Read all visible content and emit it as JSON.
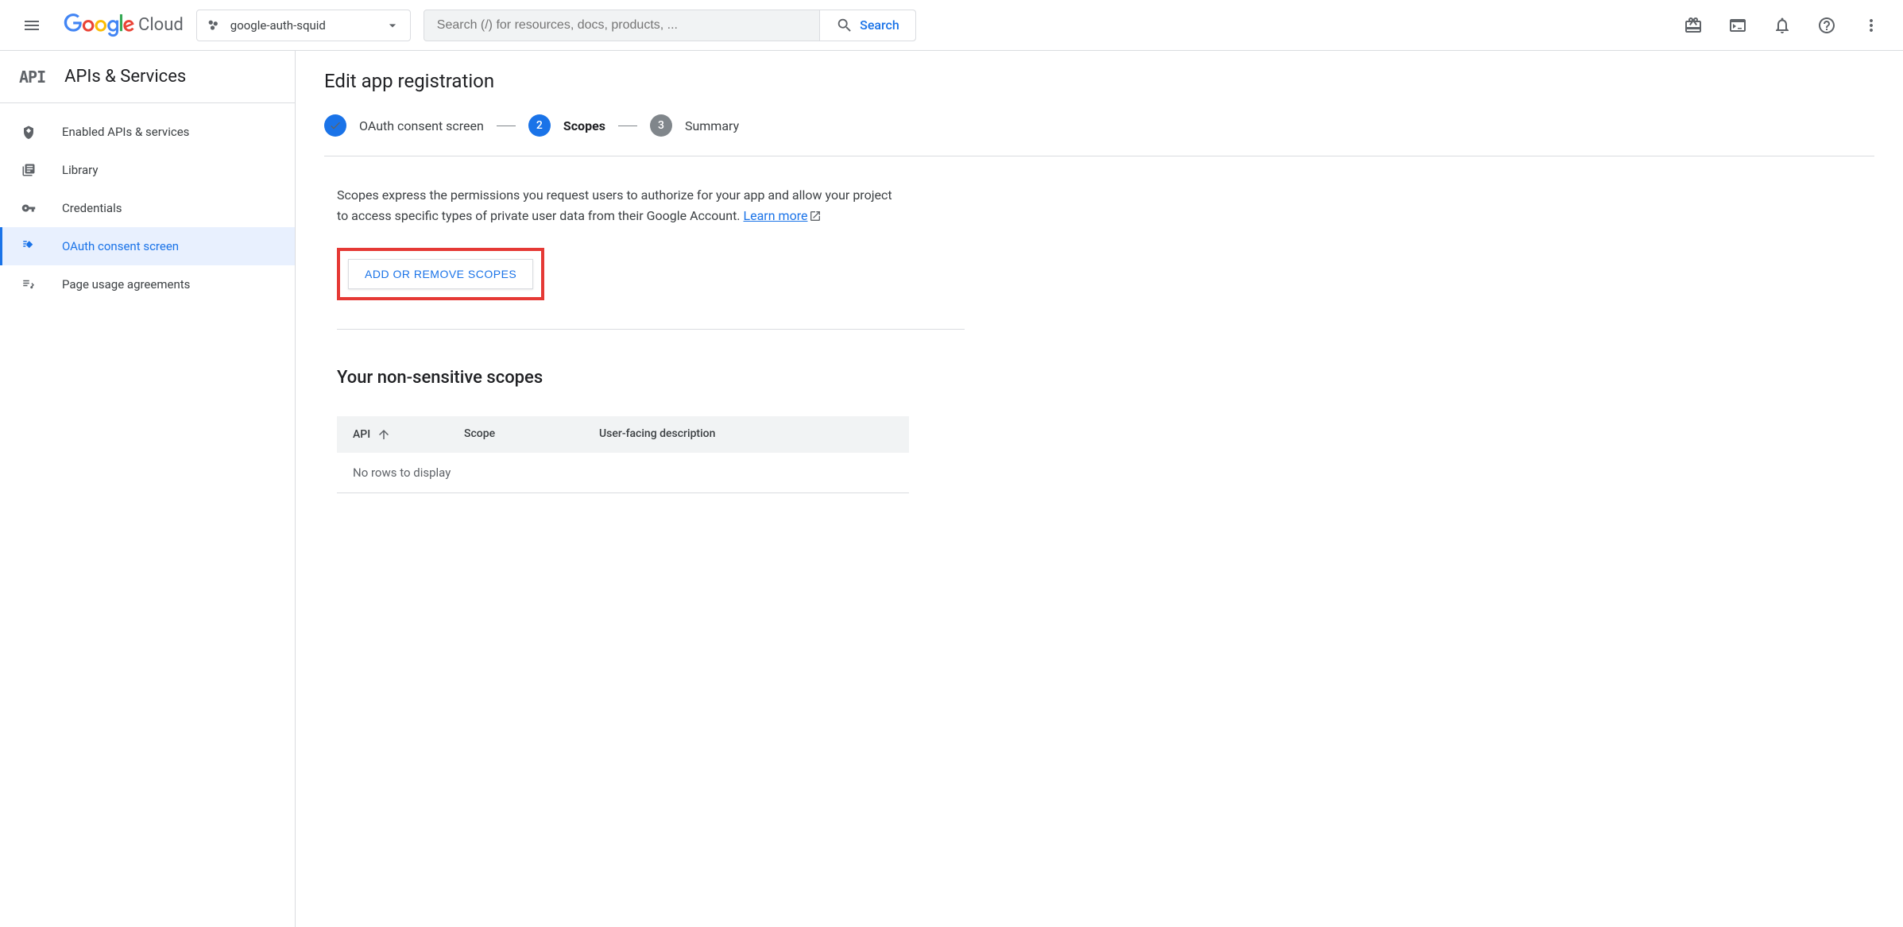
{
  "header": {
    "platform_name": "Cloud",
    "project_name": "google-auth-squid",
    "search_placeholder": "Search (/) for resources, docs, products, ...",
    "search_button": "Search"
  },
  "sidebar": {
    "title": "APIs & Services",
    "items": [
      {
        "label": "Enabled APIs & services"
      },
      {
        "label": "Library"
      },
      {
        "label": "Credentials"
      },
      {
        "label": "OAuth consent screen"
      },
      {
        "label": "Page usage agreements"
      }
    ]
  },
  "main": {
    "page_title": "Edit app registration",
    "steps": [
      {
        "label": "OAuth consent screen"
      },
      {
        "label": "Scopes",
        "number": "2"
      },
      {
        "label": "Summary",
        "number": "3"
      }
    ],
    "description": "Scopes express the permissions you request users to authorize for your app and allow your project to access specific types of private user data from their Google Account. ",
    "learn_more": "Learn more",
    "add_scopes_button": "ADD OR REMOVE SCOPES",
    "section_title": "Your non-sensitive scopes",
    "table": {
      "columns": {
        "api": "API",
        "scope": "Scope",
        "description": "User-facing description"
      },
      "empty": "No rows to display"
    }
  }
}
